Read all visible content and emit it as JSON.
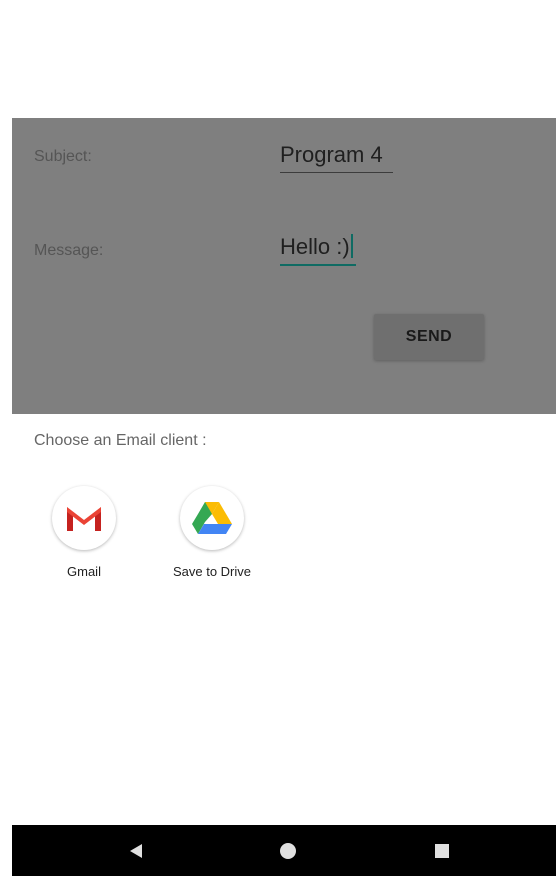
{
  "form": {
    "subject_label": "Subject:",
    "subject_value": "Program 4",
    "message_label": "Message:",
    "message_value": "Hello :)",
    "send_label": "SEND"
  },
  "chooser": {
    "title": "Choose an Email client :",
    "apps": [
      {
        "label": "Gmail",
        "icon": "gmail-icon"
      },
      {
        "label": "Save to Drive",
        "icon": "google-drive-icon"
      }
    ]
  },
  "nav": {
    "icons": [
      "back-icon",
      "home-icon",
      "recent-apps-icon"
    ]
  },
  "colors": {
    "scrim": "#7f7f7f",
    "accent": "#0f6b63",
    "gmail_red": "#d44638",
    "drive_yellow": "#fbbc04",
    "drive_green": "#34a853",
    "drive_blue": "#4285f4"
  }
}
